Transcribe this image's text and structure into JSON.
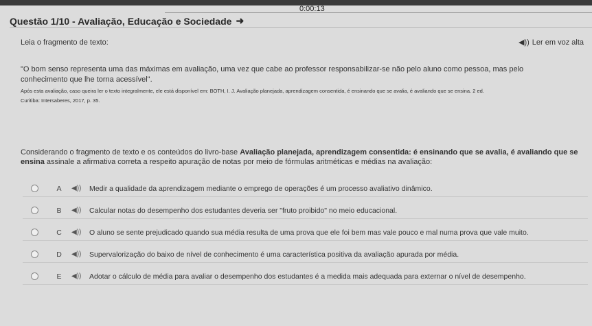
{
  "timer": "0:00:13",
  "title": "Questão 1/10 - Avaliação, Educação e Sociedade",
  "title_icon": "arrow-right-icon",
  "lead": "Leia o fragmento de texto:",
  "listen_label": "Ler em voz alta",
  "quote": "\"O bom senso representa uma das máximas em avaliação, uma vez que cabe ao professor responsabilizar-se não pelo aluno como pessoa, mas pelo conhecimento que lhe torna acessível\".",
  "reference_line1": "Após esta avaliação, caso queira ler o texto integralmente, ele está disponível em: BOTH, I. J. Avaliação planejada, aprendizagem consentida, é ensinando que se avalia, é avaliando que se ensina. 2 ed.",
  "reference_line2": "Curitiba: Intersaberes, 2017, p. 35.",
  "stem": {
    "part1": "Considerando o fragmento de texto e os conteúdos do livro-base ",
    "bold": "Avaliação planejada, aprendizagem consentida: é ensinando que se avalia, é avaliando que se ensina",
    "part2": " assinale a afirmativa correta a respeito apuração de notas por meio de fórmulas aritméticas e médias na avaliação:"
  },
  "options": [
    {
      "letter": "A",
      "text": "Medir a qualidade da aprendizagem mediante o emprego de operações é um processo avaliativo dinâmico."
    },
    {
      "letter": "B",
      "text": "Calcular notas do desempenho dos estudantes deveria ser \"fruto proibido\" no meio educacional."
    },
    {
      "letter": "C",
      "text": "O aluno se sente prejudicado quando sua média resulta de uma prova que ele foi bem mas vale pouco e mal numa prova que vale muito."
    },
    {
      "letter": "D",
      "text": "Supervalorização do baixo de nível de conhecimento é uma característica positiva da avaliação apurada por média."
    },
    {
      "letter": "E",
      "text": "Adotar o cálculo de média para avaliar o desempenho dos estudantes é a medida mais adequada para externar o nível de desempenho."
    }
  ],
  "speaker_icon": "speaker-icon"
}
